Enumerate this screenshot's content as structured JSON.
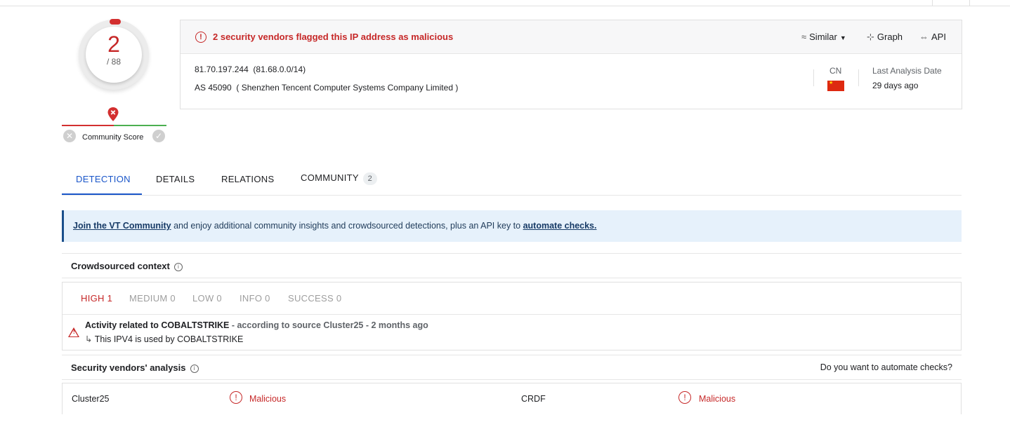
{
  "score": {
    "detections": "2",
    "total": "/ 88"
  },
  "community_score": {
    "label": "Community Score"
  },
  "summary": {
    "alert": "2 security vendors flagged this IP address as malicious",
    "actions": {
      "similar": "Similar",
      "graph": "Graph",
      "api": "API"
    },
    "ip": "81.70.197.244",
    "network": "(81.68.0.0/14)",
    "as_number": "AS 45090",
    "as_owner": "( Shenzhen Tencent Computer Systems Company Limited )",
    "country": "CN",
    "last_analysis_label": "Last Analysis Date",
    "last_analysis_value": "29 days ago"
  },
  "tabs": {
    "detection": "DETECTION",
    "details": "DETAILS",
    "relations": "RELATIONS",
    "community": "COMMUNITY",
    "community_count": "2"
  },
  "banner": {
    "link1": "Join the VT Community",
    "middle": " and enjoy additional community insights and crowdsourced detections, plus an API key to ",
    "link2": "automate checks."
  },
  "crowdsourced": {
    "title": "Crowdsourced context",
    "severities": {
      "high": "HIGH 1",
      "medium": "MEDIUM 0",
      "low": "LOW 0",
      "info": "INFO 0",
      "success": "SUCCESS 0"
    },
    "activity_title": "Activity related to COBALTSTRIKE",
    "activity_meta": " - according to source Cluster25 - 2 months ago",
    "activity_sub": "This IPV4 is used by COBALTSTRIKE"
  },
  "vendors": {
    "title": "Security vendors' analysis",
    "automate": "Do you want to automate checks?",
    "rows": [
      {
        "left_name": "Cluster25",
        "left_result": "Malicious",
        "right_name": "CRDF",
        "right_result": "Malicious"
      }
    ]
  },
  "colors": {
    "malicious": "#c62828",
    "accent": "#1a56c9",
    "banner_bg": "#e6f1fb"
  }
}
